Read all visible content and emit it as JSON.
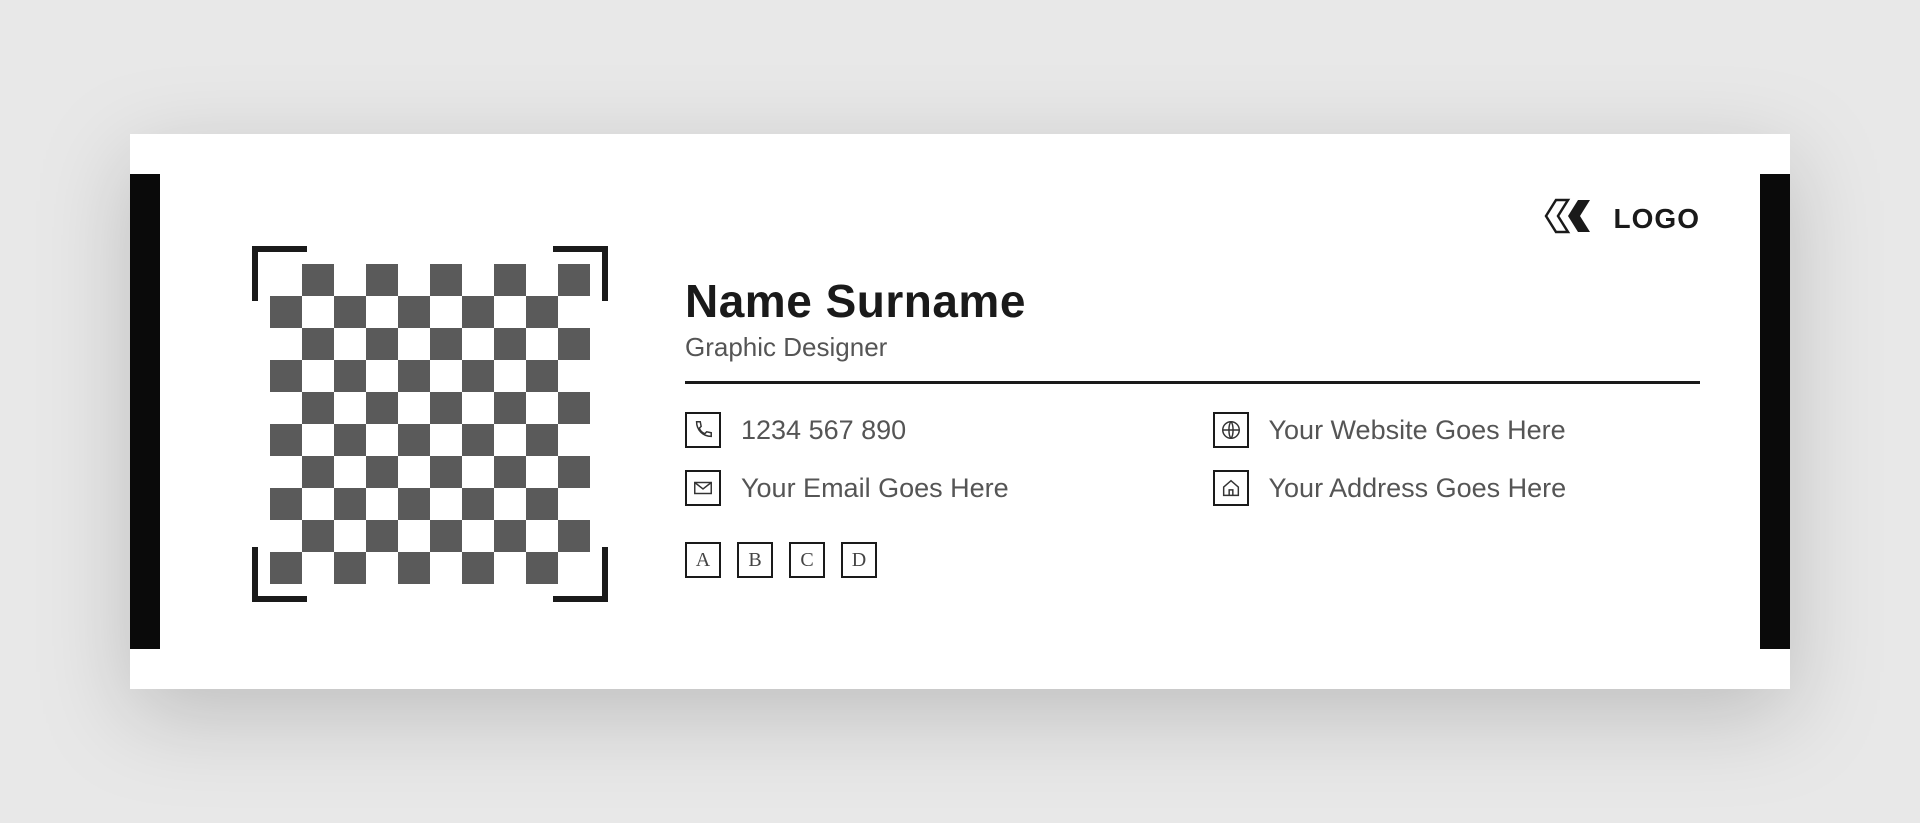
{
  "name": "Name Surname",
  "role": "Graphic Designer",
  "contacts": {
    "phone": "1234 567 890",
    "website": "Your Website Goes Here",
    "email": "Your Email Goes Here",
    "address": "Your Address Goes Here"
  },
  "social": [
    "A",
    "B",
    "C",
    "D"
  ],
  "logo_text": "LOGO"
}
